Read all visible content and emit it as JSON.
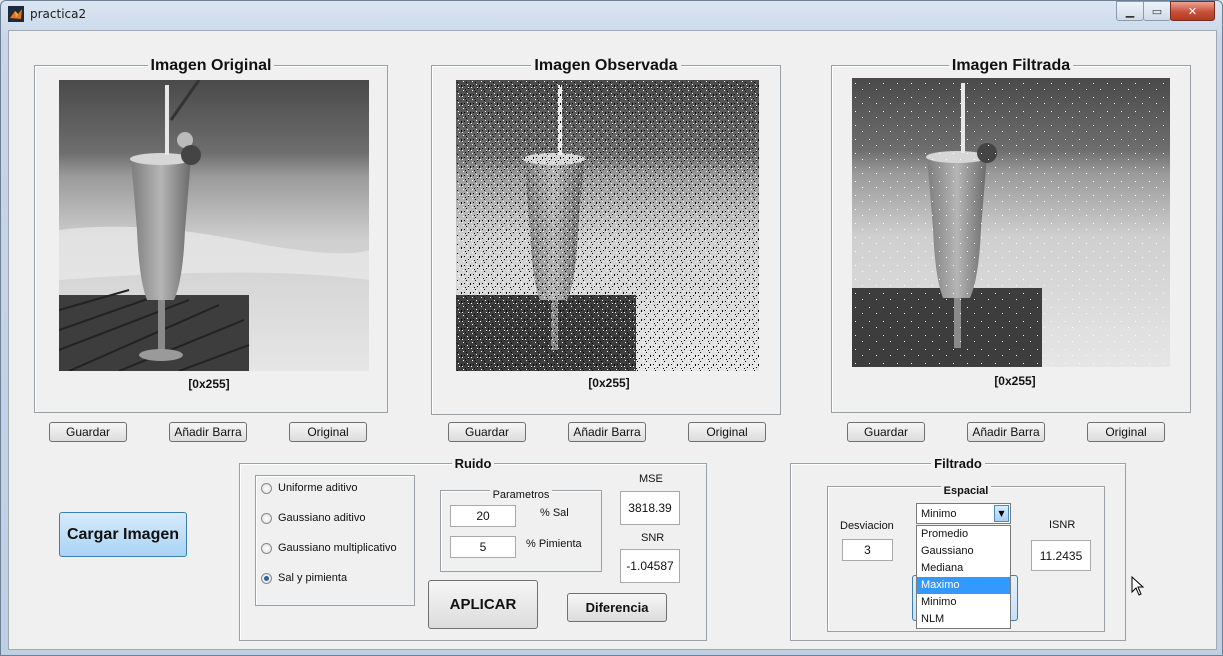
{
  "window": {
    "title": "practica2"
  },
  "panels": {
    "original": {
      "title": "Imagen Original",
      "range": "[0x255]"
    },
    "observada": {
      "title": "Imagen Observada",
      "range": "[0x255]"
    },
    "filtrada": {
      "title": "Imagen Filtrada",
      "range": "[0x255]"
    }
  },
  "image_buttons": {
    "guardar": "Guardar",
    "anadir_barra": "Añadir Barra",
    "original": "Original"
  },
  "cargar_button": "Cargar Imagen",
  "ruido": {
    "title": "Ruido",
    "options": [
      "Uniforme aditivo",
      "Gaussiano aditivo",
      "Gaussiano multiplicativo",
      "Sal y pimienta"
    ],
    "selected": "Sal y pimienta",
    "parametros": {
      "title": "Parametros",
      "sal_value": "20",
      "sal_label": "% Sal",
      "pimienta_value": "5",
      "pimienta_label": "% Pimienta"
    },
    "mse_label": "MSE",
    "mse_value": "3818.39",
    "snr_label": "SNR",
    "snr_value": "-1.04587",
    "aplicar": "APLICAR",
    "diferencia": "Diferencia"
  },
  "filtrado": {
    "title": "Filtrado",
    "espacial": {
      "title": "Espacial",
      "desviacion_label": "Desviacion",
      "desviacion_value": "3",
      "dropdown_value": "Minimo",
      "dropdown_options": [
        "Promedio",
        "Gaussiano",
        "Mediana",
        "Maximo",
        "Minimo",
        "NLM"
      ],
      "highlighted": "Maximo",
      "isnr_label": "ISNR",
      "isnr_value": "11.2435"
    }
  }
}
